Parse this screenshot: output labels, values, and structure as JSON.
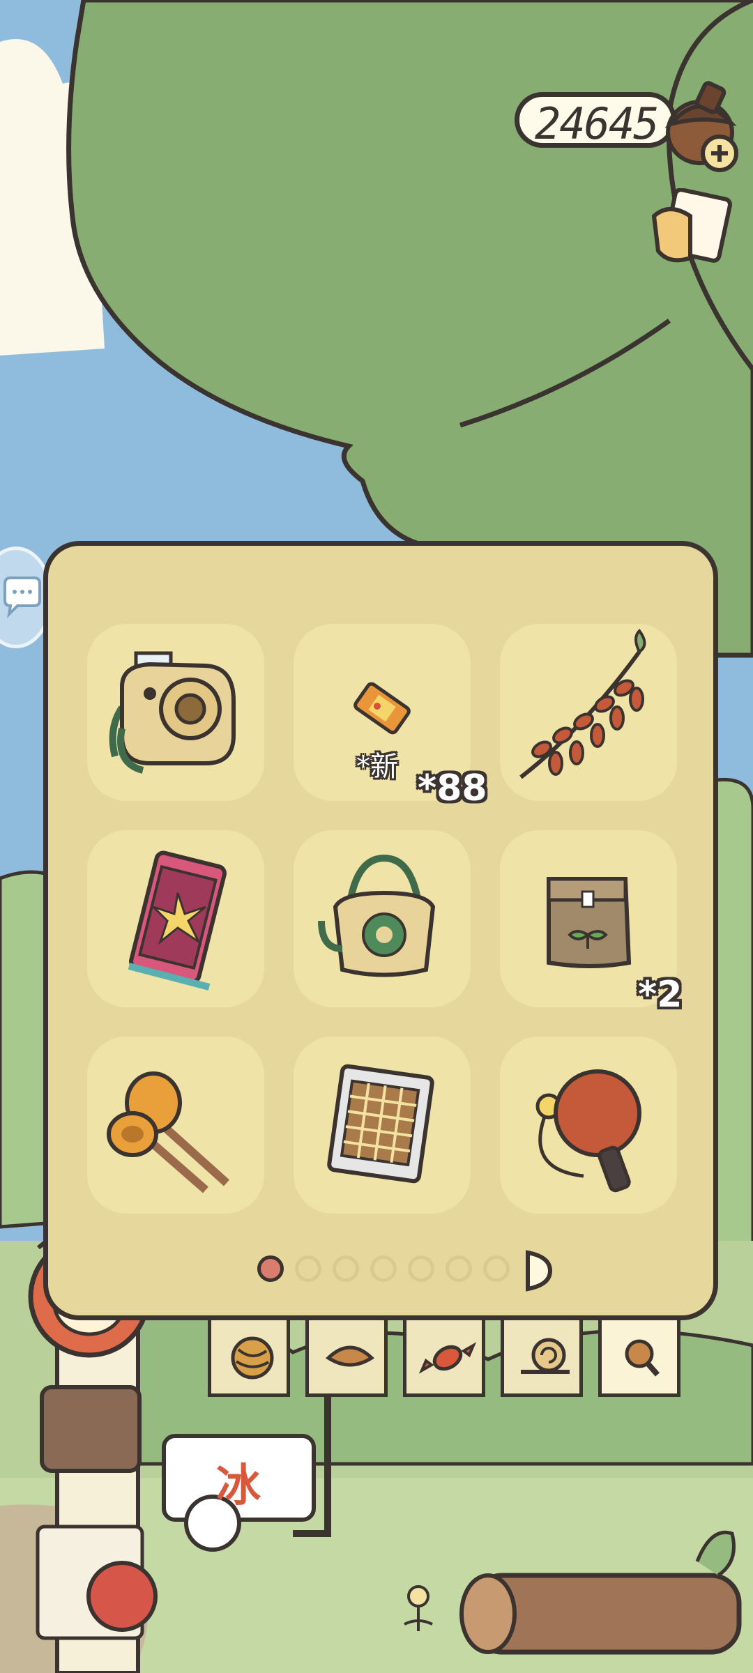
{
  "currency": {
    "amount": "24645",
    "icon": "acorn-icon",
    "add_icon": "plus-icon"
  },
  "letter_button": {
    "icon": "letter-icon"
  },
  "chat_button": {
    "icon": "chat-bubble-icon"
  },
  "inventory": {
    "page_current": 1,
    "page_total": 7,
    "items": [
      {
        "icon": "instant-camera-icon",
        "qty": ""
      },
      {
        "icon": "ticket-icon",
        "qty": "*88",
        "new_label": "*新"
      },
      {
        "icon": "dried-chili-branch-icon",
        "qty": ""
      },
      {
        "icon": "firework-box-icon",
        "qty": ""
      },
      {
        "icon": "tote-bag-icon",
        "qty": ""
      },
      {
        "icon": "seed-bag-icon",
        "qty": "*2"
      },
      {
        "icon": "maracas-icon",
        "qty": ""
      },
      {
        "icon": "puzzle-box-icon",
        "qty": ""
      },
      {
        "icon": "ping-pong-paddle-icon",
        "qty": ""
      }
    ]
  },
  "tabs": [
    {
      "icon": "yarn-ball-icon"
    },
    {
      "icon": "lunch-box-icon"
    },
    {
      "icon": "candy-icon"
    },
    {
      "icon": "snail-icon"
    },
    {
      "icon": "magnifier-icon"
    }
  ],
  "scene": {
    "cart_sign": "冰",
    "colors": {
      "sky": "#8fbbdc",
      "tree": "#87ad72",
      "grass": "#b9d09b",
      "panel": "#e6d89d",
      "outline": "#3b3330"
    }
  }
}
